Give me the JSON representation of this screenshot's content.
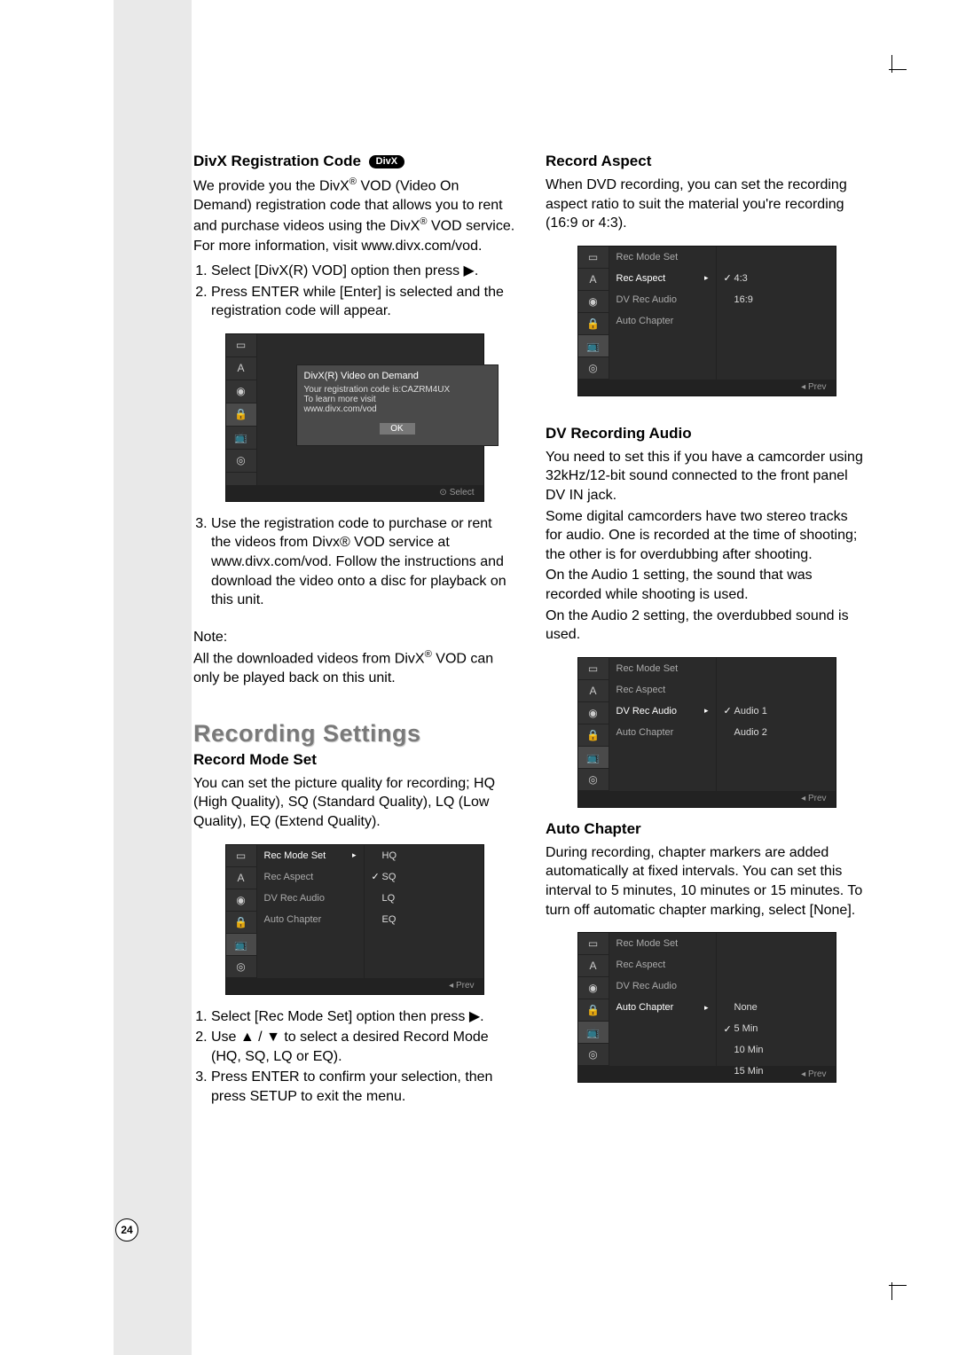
{
  "page_number": "24",
  "left": {
    "divx": {
      "heading": "DivX Registration Code",
      "pill": "DivX",
      "p1a": "We provide you the DivX",
      "p1b": " VOD (Video On Demand) registration code that allows you to rent and purchase videos using the DivX",
      "p1c": " VOD service.",
      "p2": "For more information, visit www.divx.com/vod.",
      "steps12": {
        "s1": "Select [DivX(R) VOD] option then press ▶.",
        "s2": "Press ENTER while [Enter] is selected and the registration code will appear."
      },
      "s3": "Use the registration code to purchase or rent the videos from Divx® VOD service at www.divx.com/vod. Follow the instructions and download the video onto a disc for playback on this unit.",
      "note_label": "Note:",
      "note_a": "All the downloaded videos from DivX",
      "note_b": " VOD can only be played back on this unit."
    },
    "divx_dialog": {
      "topline": "DivX(R) Video on Demand",
      "line1": "Your registration code is:CAZRM4UX",
      "line2": "To learn more visit",
      "line3": "www.divx.com/vod",
      "ok": "OK",
      "footer": "Select"
    },
    "rec": {
      "section": "Recording Settings",
      "h_mode": "Record Mode Set",
      "p": "You can set the picture quality for recording; HQ (High Quality), SQ (Standard Quality), LQ (Low Quality), EQ (Extend Quality).",
      "steps": {
        "s1": "Select [Rec Mode Set] option then press ▶.",
        "s2": "Use ▲ / ▼ to select a desired Record Mode (HQ, SQ, LQ or EQ).",
        "s3": "Press ENTER to confirm your selection, then press SETUP to exit the menu."
      }
    },
    "osd_mode": {
      "menu": [
        "Rec Mode Set",
        "Rec Aspect",
        "DV Rec Audio",
        "Auto Chapter"
      ],
      "sel_index": 0,
      "opts": [
        "HQ",
        "SQ",
        "LQ",
        "EQ"
      ],
      "checked": "SQ",
      "footer": "◂ Prev"
    }
  },
  "right": {
    "aspect": {
      "h": "Record Aspect",
      "p": "When DVD recording, you can set the recording aspect ratio to suit the material you're recording (16:9 or 4:3)."
    },
    "osd_aspect": {
      "menu": [
        "Rec Mode Set",
        "Rec Aspect",
        "DV Rec Audio",
        "Auto Chapter"
      ],
      "sel_index": 1,
      "opts": [
        "4:3",
        "16:9"
      ],
      "checked": "4:3",
      "footer": "◂ Prev"
    },
    "dvaudio": {
      "h": "DV Recording Audio",
      "p1": "You need to set this if you have a camcorder using 32kHz/12-bit sound connected to the front panel DV IN jack.",
      "p2": "Some digital camcorders have two stereo tracks for audio. One is recorded at the time of shooting; the other is for overdubbing after shooting.",
      "p3": "On the Audio 1 setting, the sound that was recorded while shooting is used.",
      "p4": "On the Audio 2 setting, the overdubbed sound is used."
    },
    "osd_dvaudio": {
      "menu": [
        "Rec Mode Set",
        "Rec Aspect",
        "DV Rec Audio",
        "Auto Chapter"
      ],
      "sel_index": 2,
      "opts": [
        "Audio 1",
        "Audio 2"
      ],
      "checked": "Audio 1",
      "footer": "◂ Prev"
    },
    "autoch": {
      "h": "Auto Chapter",
      "p": "During recording, chapter markers are added automatically at fixed intervals. You can set this interval to 5 minutes, 10 minutes or 15 minutes. To turn off automatic chapter marking, select [None]."
    },
    "osd_autoch": {
      "menu": [
        "Rec Mode Set",
        "Rec Aspect",
        "DV Rec Audio",
        "Auto Chapter"
      ],
      "sel_index": 3,
      "opts": [
        "None",
        "5 Min",
        "10 Min",
        "15 Min"
      ],
      "checked": "5 Min",
      "footer": "◂ Prev"
    }
  },
  "icons": [
    "▭",
    "A",
    "◉",
    "🔒",
    "📺",
    "◎"
  ]
}
